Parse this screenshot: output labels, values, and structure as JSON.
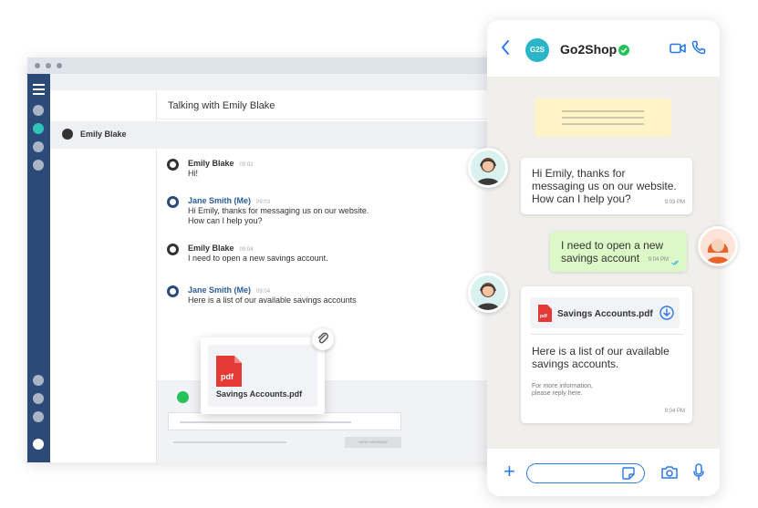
{
  "desktop": {
    "conversation_title": "Talking with Emily Blake",
    "contact_name": "Emily Blake",
    "messages": [
      {
        "sender": "Emily Blake",
        "time": "09:02",
        "lines": [
          "Hi!"
        ]
      },
      {
        "sender": "Jane Smith (Me)",
        "time": "09:03",
        "lines": [
          "Hi Emily, thanks for messaging us on our website.",
          "How can I help you?"
        ]
      },
      {
        "sender": "Emily Blake",
        "time": "09:04",
        "lines": [
          "I need to open a new savings account."
        ]
      },
      {
        "sender": "Jane Smith (Me)",
        "time": "09:04",
        "lines": [
          "Here is a list of our available savings accounts"
        ]
      }
    ],
    "attachment_name": "Savings Accounts.pdf",
    "pdf_label": "pdf",
    "send_label": "SEND MESSAGE"
  },
  "phone": {
    "avatar_initials": "G2S",
    "contact_name": "Go2Shop",
    "messages": [
      {
        "lines": [
          "Hi Emily, thanks for",
          "messaging us on our website.",
          "How can I help you?"
        ],
        "time": "9:03 PM"
      },
      {
        "lines": [
          "I need to open a new",
          "savings account"
        ],
        "time": "9:04 PM"
      },
      {
        "file_name": "Savings Accounts.pdf",
        "pdf_label": "pdf",
        "lines": [
          "Here is a list of our available",
          "savings accounts."
        ],
        "footer": [
          "For more information,",
          "please reply here."
        ],
        "time": "9:04 PM"
      }
    ]
  },
  "colors": {
    "nav": "#2c4a78",
    "brand_teal": "#2bb5c9",
    "phone_blue": "#2b79e8",
    "whatsapp_green": "#25c25a",
    "pdf_red": "#e53935",
    "bubble_green": "#dcf8c6"
  },
  "icons": [
    "menu-icon",
    "chat-icon",
    "whatsapp-icon",
    "paperclip-icon",
    "pdf-icon",
    "back-icon",
    "verified-icon",
    "video-icon",
    "phone-icon",
    "download-icon",
    "plus-icon",
    "sticker-icon",
    "camera-icon",
    "mic-icon"
  ]
}
